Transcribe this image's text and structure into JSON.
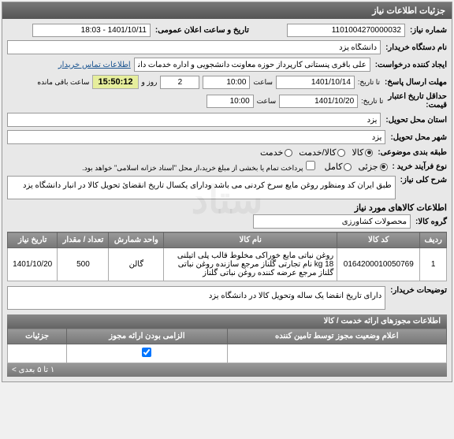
{
  "panel1": {
    "title": "جزئیات اطلاعات نیاز"
  },
  "needNumber": {
    "label": "شماره نیاز:",
    "value": "1101004270000032"
  },
  "buyer": {
    "label": "نام دستگاه خریدار:",
    "value": "دانشگاه یزد"
  },
  "requester": {
    "label": "ایجاد کننده درخواست:",
    "value": "علی باقری پنستانی کارپرداز حوزه معاونت دانشجویی و اداره خدمات دانشگاه یز",
    "contactLink": "اطلاعات تماس خریدار"
  },
  "publicDate": {
    "label": "تاریخ و ساعت اعلان عمومی:",
    "value": "1401/10/11 - 18:03"
  },
  "deadline": {
    "label": "مهلت ارسال پاسخ:",
    "prefix": "تا تاریخ:",
    "date": "1401/10/14",
    "timeLabel": "ساعت",
    "time": "10:00",
    "daysValue": "2",
    "daysLabel": "روز و",
    "countdown": "15:50:12",
    "countdownLabel": "ساعت باقی مانده"
  },
  "validity": {
    "label": "حداقل تاریخ اعتبار",
    "sublabel": "قیمت:",
    "prefix": "تا تاریخ:",
    "date": "1401/10/20",
    "timeLabel": "ساعت",
    "time": "10:00"
  },
  "deliveryProvince": {
    "label": "استان محل تحویل:",
    "value": "یزد"
  },
  "deliveryCity": {
    "label": "شهر محل تحویل:",
    "value": "یزد"
  },
  "class": {
    "label": "طبقه بندی موضوعی:",
    "options": {
      "goods": "کالا",
      "serviceGoods": "کالا/خدمت",
      "service": "خدمت"
    }
  },
  "purchaseType": {
    "label": "نوع فرآیند خرید :",
    "options": {
      "partial": "جزئی",
      "full": "کامل"
    },
    "note": "پرداخت تمام یا بخشی از مبلغ خرید،از محل \"اسناد خزانه اسلامی\" خواهد بود."
  },
  "overview": {
    "label": "شرح کلی نیاز:",
    "text": "طبق ایران کد ومنظور روغن مایع سرخ کردنی می باشد  ودارای یکسال تاریخ انقضائ تحویل کالا در انبار دانشگاه یزد"
  },
  "itemsHeader": "اطلاعات کالاهای مورد نیاز",
  "goodsGroup": {
    "label": "گروه کالا:",
    "value": "محصولات کشاورزی"
  },
  "table": {
    "headers": {
      "row": "ردیف",
      "code": "کد کالا",
      "name": "نام کالا",
      "unit": "واحد شمارش",
      "qty": "تعداد / مقدار",
      "date": "تاریخ نیاز"
    },
    "rows": [
      {
        "row": "1",
        "code": "0164200010050769",
        "name": "روغن نباتی مایع خوراکی مخلوط قالب پلی اتیلنی 18 kg نام تجارتی گلناز مرجع سازنده روغن نباتی گلناز مرجع عرضه کننده روغن نباتی گلناز",
        "unit": "گالن",
        "qty": "500",
        "date": "1401/10/20"
      }
    ]
  },
  "buyerNotes": {
    "label": "توضیحات خریدار:",
    "text": "دارای تاریخ انقضا یک ساله وتحویل کالا در دانشگاه یزد"
  },
  "permitsHeader": "اطلاعات مجوزهای ارائه خدمت / کالا",
  "permitsTable": {
    "col1": "اعلام وضعیت مجوز توسط تامین کننده",
    "col2": "الزامی بودن ارائه مجوز",
    "col3": "جزئیات"
  },
  "footer": {
    "right": "",
    "left": "۱ تا ۵ بعدی >"
  }
}
